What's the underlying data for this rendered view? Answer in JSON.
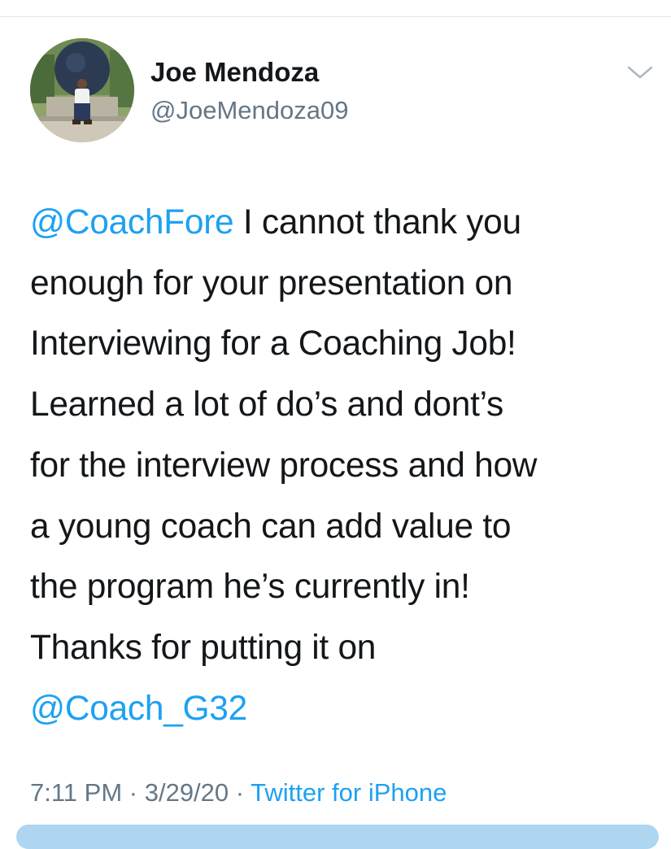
{
  "author": {
    "name": "Joe Mendoza",
    "handle": "@JoeMendoza09"
  },
  "tweet": {
    "line1_mention": "@CoachFore",
    "line1_text": " I cannot thank you",
    "line2": "enough for your presentation on",
    "line3": "Interviewing for a Coaching Job!",
    "line4": "Learned a lot of do’s and dont’s",
    "line5": "for the interview process and how",
    "line6": "a young coach can add value to",
    "line7": "the program he’s currently in!",
    "line8": "Thanks for putting it on",
    "line9_mention": "@Coach_G32"
  },
  "meta": {
    "time": "7:11 PM",
    "separator": " · ",
    "date": "3/29/20",
    "separator2": " · ",
    "source": "Twitter for iPhone"
  },
  "icons": {
    "menu": "chevron-down-icon",
    "avatar": "profile-photo"
  },
  "colors": {
    "link": "#1da1f2",
    "secondary_text": "#657786",
    "primary_text": "#14171a"
  }
}
